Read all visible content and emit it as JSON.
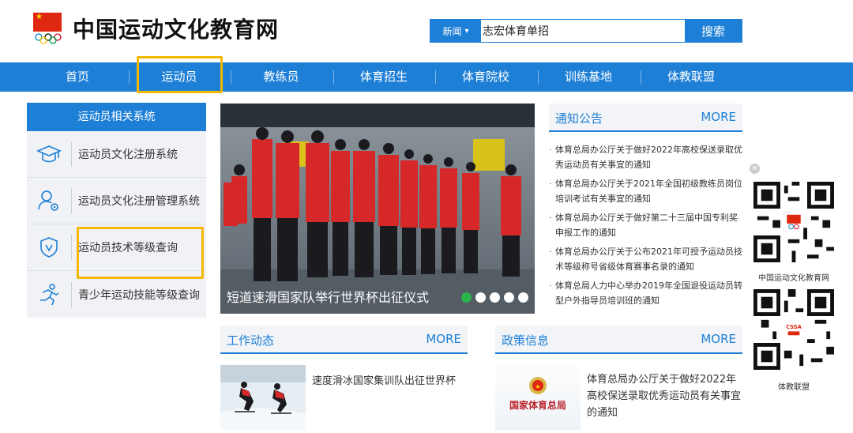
{
  "header": {
    "site_title": "中国运动文化教育网",
    "search": {
      "category": "新闻",
      "value": "志宏体育单招",
      "button": "搜索"
    }
  },
  "nav": {
    "items": [
      "首页",
      "运动员",
      "教练员",
      "体育招生",
      "体育院校",
      "训练基地",
      "体教联盟"
    ],
    "active_index": 1
  },
  "sidebar": {
    "title": "运动员相关系统",
    "items": [
      {
        "label": "运动员文化注册系统",
        "icon": "graduation-cap-icon"
      },
      {
        "label": "运动员文化注册管理系统",
        "icon": "user-settings-icon"
      },
      {
        "label": "运动员技术等级查询",
        "icon": "shield-v-icon"
      },
      {
        "label": "青少年运动技能等级查询",
        "icon": "runner-icon"
      }
    ]
  },
  "slider": {
    "caption": "短道速滑国家队举行世界杯出征仪式",
    "dots": 5,
    "active_dot": 0
  },
  "notice": {
    "title": "通知公告",
    "more": "MORE",
    "items": [
      "体育总局办公厅关于做好2022年高校保送录取优秀运动员有关事宜的通知",
      "体育总局办公厅关于2021年全国初级教练员岗位培训考试有关事宜的通知",
      "体育总局办公厅关于做好第二十三届中国专利奖申报工作的通知",
      "体育总局办公厅关于公布2021年可授予运动员技术等级称号省级体育赛事名录的通知",
      "体育总局人力中心举办2019年全国退役运动员转型户外指导员培训班的通知"
    ]
  },
  "work": {
    "title": "工作动态",
    "more": "MORE",
    "item": "速度滑冰国家集训队出征世界杯"
  },
  "policy": {
    "title": "政策信息",
    "more": "MORE",
    "item": "体育总局办公厅关于做好2022年高校保送录取优秀运动员有关事宜的通知",
    "thumb_text": "国家体育总局"
  },
  "qr": {
    "label1": "中国运动文化教育网",
    "label2": "体教联盟",
    "badge2": "CSSA"
  },
  "colors": {
    "primary": "#1e7fd6",
    "highlight": "#f5b800",
    "flag_red": "#de2910"
  }
}
